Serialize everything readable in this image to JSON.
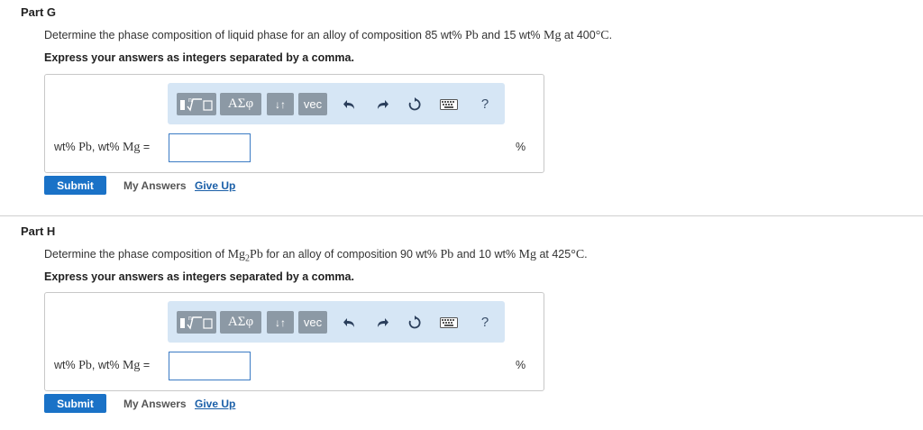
{
  "parts": [
    {
      "title": "Part G",
      "question": {
        "before": "Determine the phase composition of liquid phase for an alloy of composition 85 wt% ",
        "m1": "Pb",
        "mid": " and 15 wt% ",
        "m2": "Mg",
        "after": " at 400",
        "deg": "°",
        "unit": "C",
        "end": "."
      },
      "instruction": "Express your answers as integers separated by a comma.",
      "label": {
        "pre": "wt% ",
        "a": "Pb",
        "mid": ", wt% ",
        "b": "Mg",
        "eq": " ="
      },
      "input_value": "",
      "unit": "%",
      "submit": "Submit",
      "my_answers": "My Answers",
      "give_up": "Give Up"
    },
    {
      "title": "Part H",
      "question": {
        "before": "Determine the phase composition of ",
        "f1": "Mg",
        "sub": "2",
        "f2": "Pb",
        "mid1": " for an alloy of composition 90 wt% ",
        "m1": "Pb",
        "mid2": " and 10 wt% ",
        "m2": "Mg",
        "after": " at 425",
        "deg": "°",
        "unit": "C",
        "end": "."
      },
      "instruction": "Express your answers as integers separated by a comma.",
      "label": {
        "pre": "wt% ",
        "a": "Pb",
        "mid": ", wt% ",
        "b": "Mg",
        "eq": " ="
      },
      "input_value": "",
      "unit": "%",
      "submit": "Submit",
      "my_answers": "My Answers",
      "give_up": "Give Up"
    }
  ],
  "toolbar": {
    "greek": "ΑΣφ",
    "arrows": "↓↑",
    "vec": "vec",
    "help": "?",
    "icons": [
      "templates-icon",
      "greek-icon",
      "arrows-icon",
      "vec-icon",
      "undo-icon",
      "redo-icon",
      "reset-icon",
      "keyboard-icon",
      "help-icon"
    ]
  },
  "colors": {
    "toolbar_bg": "#d6e6f5",
    "toolbar_btn": "#8c99a5",
    "submit_bg": "#1a72c7",
    "link": "#1a5fa8",
    "input_border": "#3b7bc4"
  }
}
